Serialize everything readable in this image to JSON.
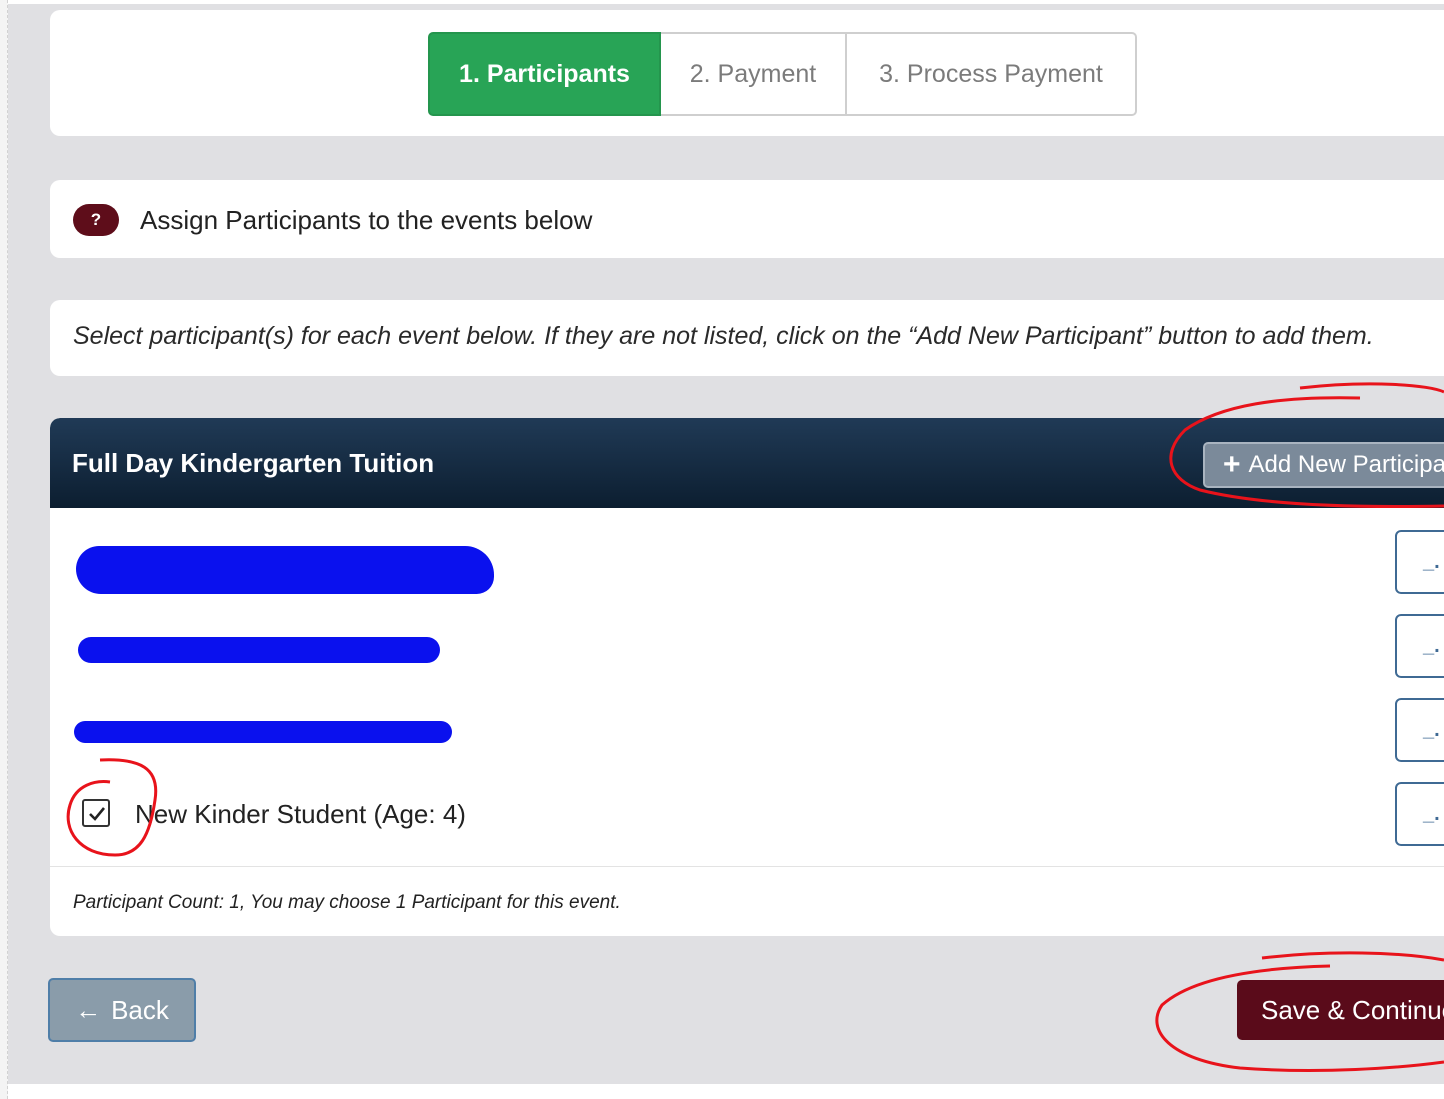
{
  "steps": [
    {
      "label": "1. Participants",
      "active": true
    },
    {
      "label": "2. Payment",
      "active": false
    },
    {
      "label": "3. Process Payment",
      "active": false
    }
  ],
  "help": {
    "badge": "?",
    "text": "Assign Participants to the events below"
  },
  "instructions": "Select participant(s) for each event below.  If they are not listed, click on the “Add New Participant” button to add them.",
  "event": {
    "title": "Full Day Kindergarten Tuition",
    "add_button": "Add New Participant",
    "participants": [
      {
        "label": "",
        "checked": false,
        "redacted": true
      },
      {
        "label": "",
        "checked": false,
        "redacted": true
      },
      {
        "label": "",
        "checked": false,
        "redacted": true
      },
      {
        "label": "New Kinder Student (Age: 4)",
        "checked": true,
        "redacted": false
      }
    ],
    "count_text": "Participant Count: 1, You may choose 1 Participant for this event."
  },
  "footer": {
    "back_label": "Back",
    "save_label": "Save & Continue"
  },
  "colors": {
    "active_step": "#28a456",
    "brand": "#5a0b1a",
    "header": "#0c1e30",
    "annotation": "#e8131b",
    "redaction": "#0a11ee"
  },
  "icons": {
    "help": "question-icon",
    "add": "plus-icon",
    "back": "arrow-left-icon",
    "edit": "edit-icon"
  }
}
